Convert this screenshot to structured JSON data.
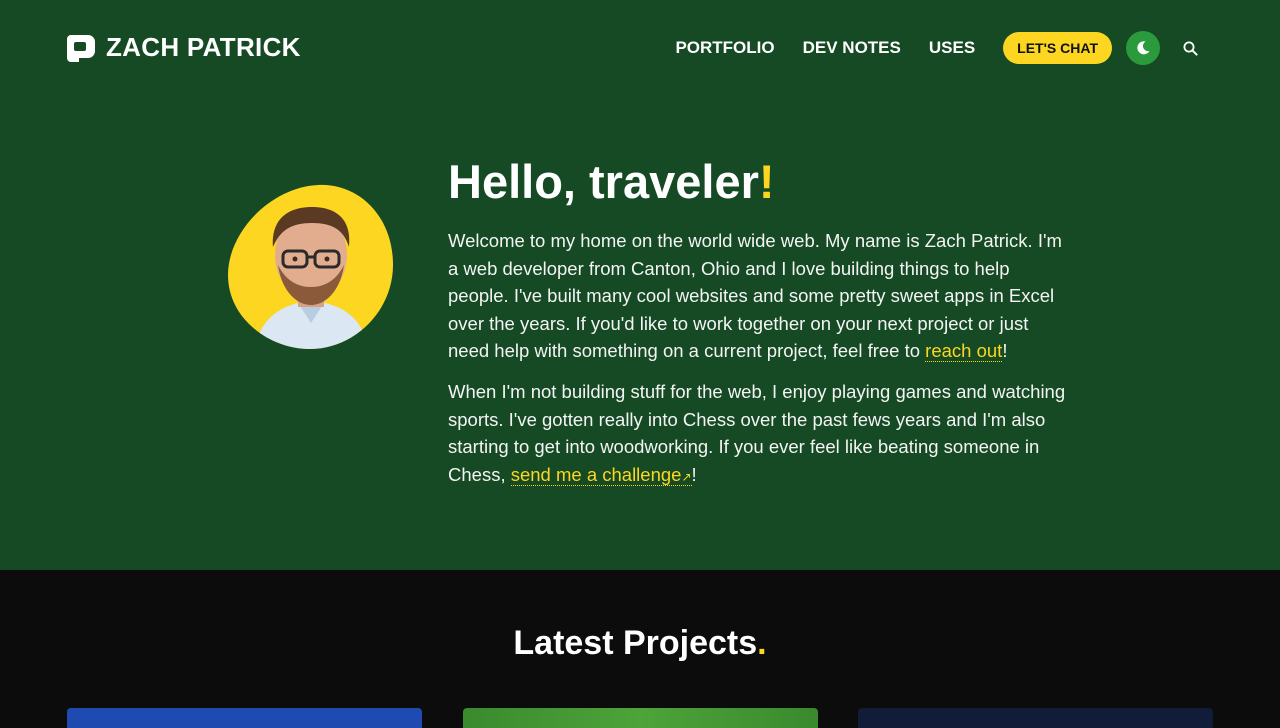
{
  "brand": {
    "name": "ZACH PATRICK"
  },
  "nav": {
    "items": [
      {
        "label": "PORTFOLIO"
      },
      {
        "label": "DEV NOTES"
      },
      {
        "label": "USES"
      }
    ],
    "cta_label": "LET'S CHAT",
    "theme_toggle_icon": "moon-icon",
    "search_icon": "search-icon"
  },
  "hero": {
    "title": "Hello, traveler",
    "title_punct": "!",
    "p1": {
      "text": "Welcome to my home on the world wide web. My name is Zach Patrick. I'm a web developer from Canton, Ohio and I love building things to help people. I've built many cool websites and some pretty sweet apps in Excel over the years. If you'd like to work together on your next project or just need help with something on a current project, feel free to ",
      "link": "reach out",
      "tail": "!"
    },
    "p2": {
      "text": "When I'm not building stuff for the web, I enjoy playing games and watching sports. I've gotten really into Chess over the past fews years and I'm also starting to get into woodworking. If you ever feel like beating someone in Chess, ",
      "link": "send me a challenge",
      "link_icon": "↗",
      "tail": "!"
    }
  },
  "projects": {
    "title": "Latest Projects",
    "title_punct": "."
  },
  "colors": {
    "hero_bg": "#154a24",
    "accent": "#fcd621",
    "page_bg": "#0c0c0c",
    "toggle_bg": "#2a9a3d"
  }
}
